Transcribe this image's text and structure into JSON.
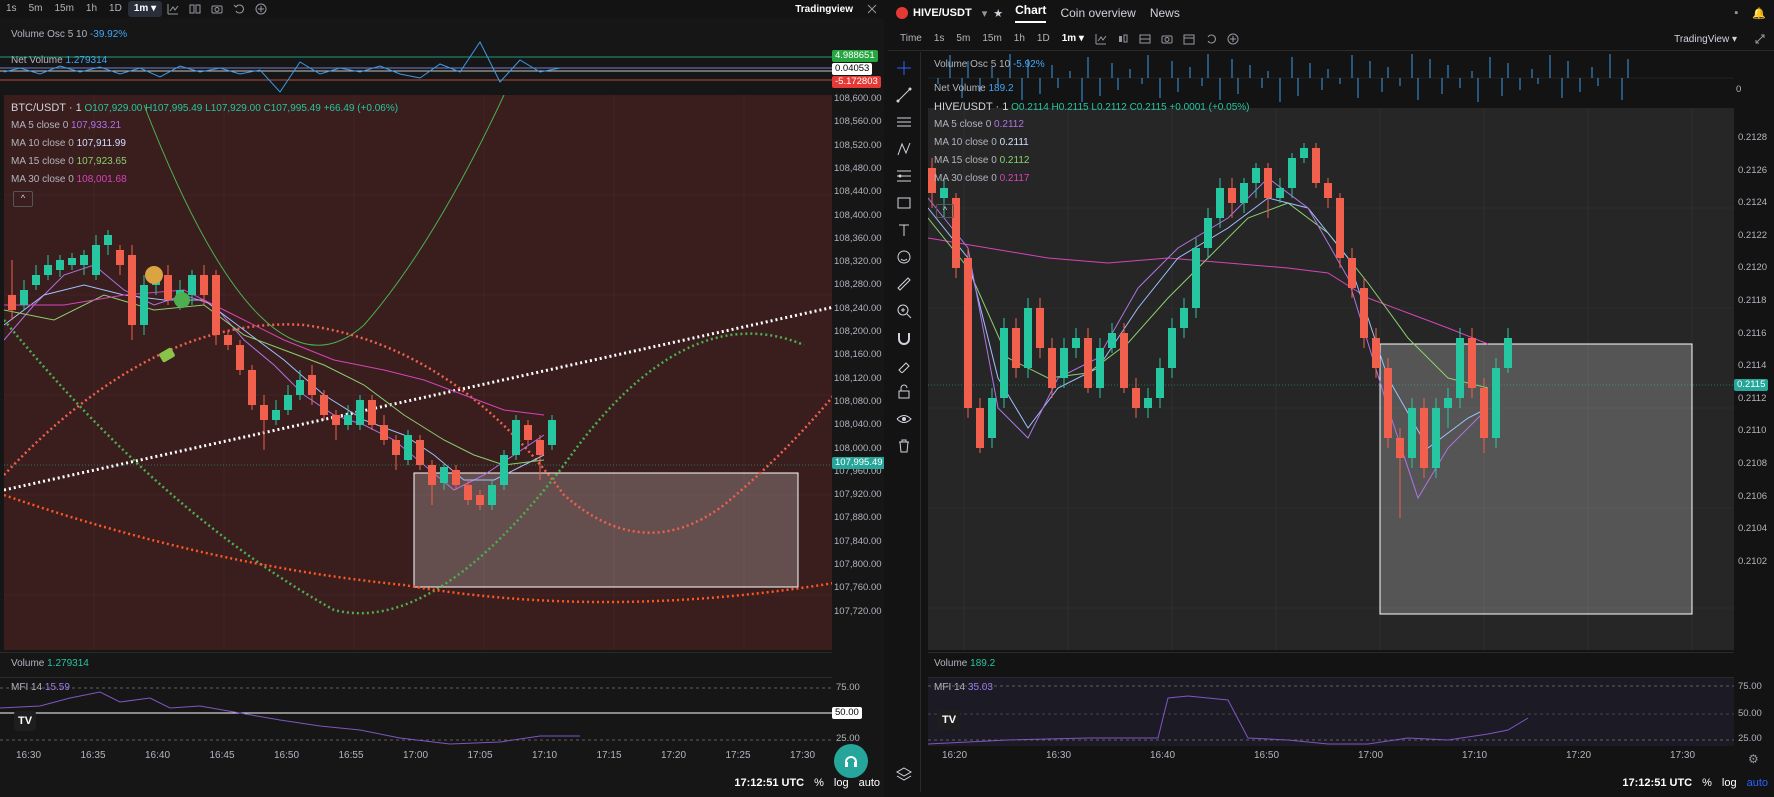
{
  "left": {
    "timeframes": [
      "1s",
      "5m",
      "15m",
      "1h",
      "1D"
    ],
    "timeframe_active": "1m ▾",
    "brand": "Tradingview",
    "vol_osc": {
      "label": "Volume Osc 5 10",
      "value": "-39.92%"
    },
    "net_volume": {
      "label": "Net Volume",
      "value": "1.279314"
    },
    "osc_tags": {
      "top": "4.988651",
      "mid": "0.04053",
      "bottom": "-5.172803"
    },
    "symbol": "BTC/USDT · 1",
    "ohlc": "O107,929.00 H107,995.49 L107,929.00 C107,995.49 +66.49 (+0.06%)",
    "ma": [
      {
        "label": "MA 5 close 0",
        "value": "107,933.21",
        "color": "#b073e6"
      },
      {
        "label": "MA 10 close 0",
        "value": "107,911.99",
        "color": "#9ec1ff"
      },
      {
        "label": "MA 15 close 0",
        "value": "107,923.65",
        "color": "#8bcf6e"
      },
      {
        "label": "MA 30 close 0",
        "value": "108,001.68",
        "color": "#d545b8"
      }
    ],
    "price_axis": [
      "108,600.00",
      "108,560.00",
      "108,520.00",
      "108,480.00",
      "108,440.00",
      "108,400.00",
      "108,360.00",
      "108,320.00",
      "108,280.00",
      "108,240.00",
      "108,200.00",
      "108,160.00",
      "108,120.00",
      "108,080.00",
      "108,040.00",
      "108,000.00",
      "107,960.00",
      "107,920.00",
      "107,880.00",
      "107,840.00",
      "107,800.00",
      "107,760.00",
      "107,720.00"
    ],
    "last_price": "107,995.49",
    "volume": {
      "label": "Volume",
      "value": "1.279314"
    },
    "mfi": {
      "label": "MFI 14",
      "value": "15.59"
    },
    "mfi_axis": [
      "75.00",
      "50.00",
      "25.00"
    ],
    "mfi_tag": "50.00",
    "times": [
      "16:30",
      "16:35",
      "16:40",
      "16:45",
      "16:50",
      "16:55",
      "17:00",
      "17:05",
      "17:10",
      "17:15",
      "17:20",
      "17:25",
      "17:30"
    ],
    "clock": "17:12:51 UTC",
    "pct": "%",
    "log": "log",
    "auto": "auto"
  },
  "right": {
    "symbol_header": "HIVE/USDT",
    "tabs": [
      "Chart",
      "Coin overview",
      "News"
    ],
    "timeframes": [
      "Time",
      "1s",
      "5m",
      "15m",
      "1h",
      "1D"
    ],
    "timeframe_active": "1m ▾",
    "brand": "TradingView ▾",
    "vol_osc": {
      "label": "Volume Osc 5 10",
      "value": "-5.92%"
    },
    "net_volume": {
      "label": "Net Volume",
      "value": "189.2"
    },
    "net_tag": "0",
    "symbol": "HIVE/USDT · 1",
    "ohlc": "O0.2114 H0.2115 L0.2112 C0.2115 +0.0001 (+0.05%)",
    "ma": [
      {
        "label": "MA 5 close 0",
        "value": "0.2112",
        "color": "#b073e6"
      },
      {
        "label": "MA 10 close 0",
        "value": "0.2111",
        "color": "#9ec1ff"
      },
      {
        "label": "MA 15 close 0",
        "value": "0.2112",
        "color": "#8bcf6e"
      },
      {
        "label": "MA 30 close 0",
        "value": "0.2117",
        "color": "#d545b8"
      }
    ],
    "price_axis": [
      "0.2128",
      "0.2126",
      "0.2124",
      "0.2122",
      "0.2120",
      "0.2118",
      "0.2116",
      "0.2114",
      "0.2112",
      "0.2110",
      "0.2108",
      "0.2106",
      "0.2104",
      "0.2102"
    ],
    "last_price": "0.2115",
    "volume": {
      "label": "Volume",
      "value": "189.2"
    },
    "mfi": {
      "label": "MFI 14",
      "value": "35.03"
    },
    "mfi_axis": [
      "75.00",
      "50.00",
      "25.00"
    ],
    "times": [
      "16:20",
      "16:30",
      "16:40",
      "16:50",
      "17:00",
      "17:10",
      "17:20",
      "17:30"
    ],
    "clock": "17:12:51 UTC",
    "pct": "%",
    "log": "log",
    "auto": "auto"
  },
  "colors": {
    "up": "#26c6a0",
    "down": "#f0604d",
    "accent": "#2962ff",
    "support": "#26a69a"
  }
}
